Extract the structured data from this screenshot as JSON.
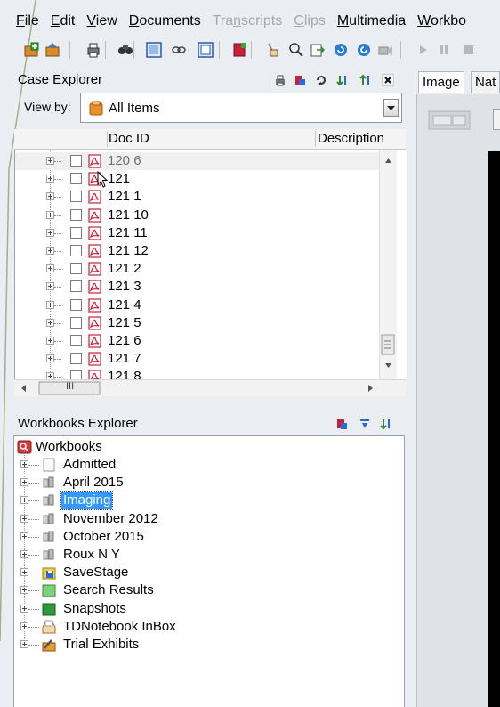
{
  "menubar": {
    "items": [
      {
        "label": "File",
        "underline_index": 0,
        "disabled": false
      },
      {
        "label": "Edit",
        "underline_index": 0,
        "disabled": false
      },
      {
        "label": "View",
        "underline_index": 0,
        "disabled": false
      },
      {
        "label": "Documents",
        "underline_index": 0,
        "disabled": false
      },
      {
        "label": "Transcripts",
        "underline_index": 3,
        "disabled": true
      },
      {
        "label": "Clips",
        "underline_index": 0,
        "disabled": true
      },
      {
        "label": "Multimedia",
        "underline_index": 0,
        "disabled": false
      },
      {
        "label": "Workbo",
        "underline_index": 0,
        "disabled": false
      }
    ]
  },
  "toolbar": {
    "icons": [
      "add-case-icon",
      "open-case-icon",
      "print-icon",
      "find-icon",
      "view-layout-icon",
      "link-icon",
      "frame-icon",
      "book-icon",
      "brush-icon",
      "zoom-icon",
      "export-icon",
      "refresh-icon",
      "redo-icon",
      "camera-icon",
      "play-icon",
      "pause-icon",
      "stop-icon"
    ]
  },
  "case_explorer": {
    "title": "Case Explorer",
    "header_icons": [
      "print-icon",
      "tag-icon",
      "refresh-icon",
      "import-icon",
      "export-icon",
      "close-icon"
    ],
    "view_by_label": "View by:",
    "view_by_value": "All Items",
    "columns": [
      "Doc ID",
      "Description"
    ],
    "documents": [
      "120 6",
      "121",
      "121 1",
      "121 10",
      "121 11",
      "121 12",
      "121 2",
      "121 3",
      "121 4",
      "121 5",
      "121 6",
      "121 7",
      "121 8"
    ],
    "hscroll_thumb_label": "III"
  },
  "workbooks_explorer": {
    "title": "Workbooks Explorer",
    "header_icons": [
      "tag-icon",
      "sort-down-icon",
      "import-icon"
    ],
    "root": "Workbooks",
    "items": [
      {
        "label": "Admitted",
        "icon": "page-icon",
        "selected": false
      },
      {
        "label": "April 2015",
        "icon": "binder-icon",
        "selected": false
      },
      {
        "label": "Imaging",
        "icon": "binder-icon",
        "selected": true
      },
      {
        "label": "November 2012",
        "icon": "binder-icon",
        "selected": false
      },
      {
        "label": "October 2015",
        "icon": "binder-icon",
        "selected": false
      },
      {
        "label": "Roux N Y",
        "icon": "binder-icon",
        "selected": false
      },
      {
        "label": "SaveStage",
        "icon": "save-folder-icon",
        "selected": false
      },
      {
        "label": "Search Results",
        "icon": "green-folder-icon",
        "selected": false
      },
      {
        "label": "Snapshots",
        "icon": "dark-green-folder-icon",
        "selected": false
      },
      {
        "label": "TDNotebook InBox",
        "icon": "inbox-icon",
        "selected": false
      },
      {
        "label": "Trial Exhibits",
        "icon": "exhibit-icon",
        "selected": false
      }
    ]
  },
  "viewer": {
    "tabs": [
      "Image",
      "Nat"
    ]
  }
}
